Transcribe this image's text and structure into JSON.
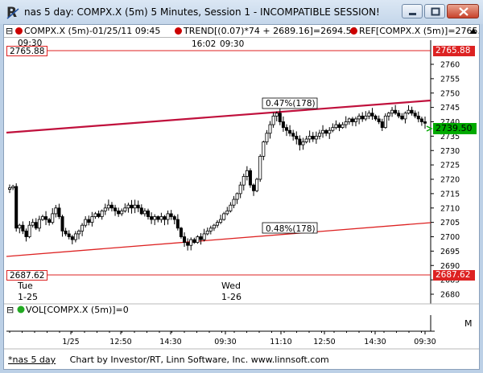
{
  "window": {
    "title": "nas 5 day: COMPX.X (5m) 5 Minutes, Session 1 - INCOMPATIBLE SESSION!",
    "app_icon": "chart-r-icon",
    "controls": [
      "minimize-icon",
      "maximize-icon",
      "close-icon"
    ]
  },
  "legend": {
    "items": [
      {
        "label": "COMPX.X (5m)-01/25/11 09:45",
        "color": "#cc0000"
      },
      {
        "label": "TREND[(0.07)*74 + 2689.16]=2694.53",
        "color": "#cc0000"
      },
      {
        "label": "REF[COMPX.X (5m)]=2765.",
        "color": "#cc0000"
      }
    ],
    "scroll_up_icon": "arrow-up-icon"
  },
  "top_labels": {
    "left_time": "09:30",
    "center_time1": "16:02",
    "center_time2": "09:30"
  },
  "ref_lines": {
    "upper": "2765.88",
    "lower": "2687.62"
  },
  "channel_labels": {
    "upper": "0.47%(178)",
    "lower": "0.48%(178)"
  },
  "current_price": "2739.50",
  "price_axis": [
    "2760",
    "2755",
    "2750",
    "2745",
    "2740",
    "2735",
    "2730",
    "2725",
    "2720",
    "2715",
    "2710",
    "2705",
    "2700",
    "2695",
    "2690",
    "2685",
    "2680"
  ],
  "day_labels": [
    {
      "day": "Tue",
      "date": "1-25"
    },
    {
      "day": "Wed",
      "date": "1-26"
    }
  ],
  "volume_pane": {
    "legend": "VOL[COMPX.X (5m)]=0",
    "color": "#22aa22",
    "max_icon": "M"
  },
  "time_axis": [
    "1/25",
    "12:50",
    "14:30",
    "09:30",
    "11:10",
    "12:50",
    "14:30",
    "09:30"
  ],
  "statusbar": {
    "tab": "*nas 5 day",
    "credit": "Chart by Investor/RT, Linn Software, Inc. www.linnsoft.com"
  },
  "colors": {
    "ref_line": "#dd2222",
    "trend_upper": "#c0103c",
    "trend_lower": "#dd2222",
    "candles": "#000000",
    "current_price_bg": "#00aa00"
  },
  "chart_data": {
    "type": "candlestick",
    "ylim": [
      2680,
      2767
    ],
    "reference_lines": [
      2765.88,
      2687.62
    ],
    "trend_channel": {
      "upper": [
        2738,
        2748.5
      ],
      "lower": [
        2693.5,
        2704.5
      ]
    },
    "last": 2739.5,
    "x_ticks": [
      "1/25",
      "12:50",
      "14:30",
      "09:30",
      "11:10",
      "12:50",
      "14:30",
      "09:30"
    ],
    "close_path": [
      2717,
      2717.5,
      2703,
      2704,
      2702,
      2700,
      2704,
      2705,
      2703,
      2706,
      2707,
      2706,
      2705,
      2708,
      2710,
      2707,
      2702,
      2701,
      2700,
      2699,
      2701,
      2702,
      2704,
      2706,
      2705,
      2707,
      2708,
      2707,
      2709,
      2710,
      2711,
      2710,
      2709,
      2708,
      2709,
      2710,
      2711,
      2710,
      2711,
      2710,
      2708,
      2709,
      2707,
      2706,
      2707,
      2706,
      2707,
      2706,
      2708,
      2707,
      2706,
      2703,
      2700,
      2698,
      2697,
      2699,
      2698,
      2700,
      2699,
      2701,
      2702,
      2703,
      2704,
      2705,
      2706,
      2708,
      2709,
      2711,
      2713,
      2715,
      2718,
      2721,
      2723,
      2718,
      2716,
      2720,
      2728,
      2733,
      2736,
      2739,
      2742,
      2743,
      2740,
      2738,
      2737,
      2736,
      2735,
      2734,
      2732,
      2733,
      2734,
      2735,
      2734,
      2735,
      2736,
      2737,
      2736,
      2737,
      2738,
      2739,
      2738,
      2739,
      2740,
      2741,
      2740,
      2741,
      2742,
      2741,
      2742,
      2743,
      2742,
      2741,
      2740,
      2738,
      2742,
      2743,
      2744,
      2743,
      2742,
      2741,
      2743,
      2744,
      2743,
      2742,
      2741,
      2740,
      2739.5
    ]
  }
}
